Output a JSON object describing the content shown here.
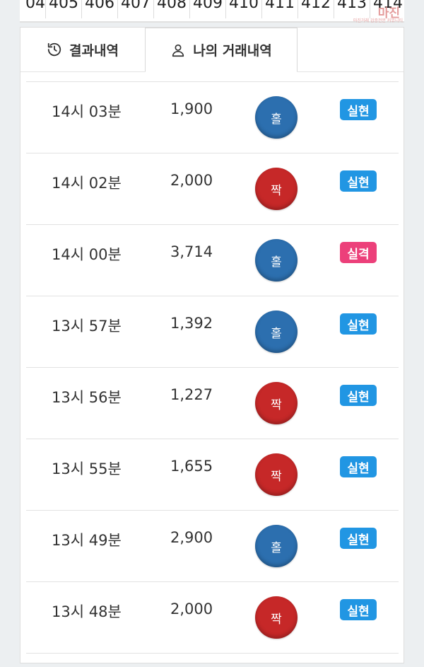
{
  "round_numbers": [
    "04",
    "405",
    "406",
    "407",
    "408",
    "409",
    "410",
    "411",
    "412",
    "413",
    "414"
  ],
  "watermark": {
    "text": "마진",
    "sub": "마진거래 검증전문 커뮤니티"
  },
  "tabs": [
    {
      "label": "결과내역",
      "icon": "history-icon"
    },
    {
      "label": "나의 거래내역",
      "icon": "user-icon",
      "active": true
    }
  ],
  "colors": {
    "odd": "#2c6faf",
    "even": "#c62828",
    "win": "#2196e3",
    "lose": "#ec407a"
  },
  "rows": [
    {
      "time": "14시 03분",
      "amount": "1,900",
      "pick": "홀",
      "pick_type": "odd",
      "result": "실현",
      "result_type": "win"
    },
    {
      "time": "14시 02분",
      "amount": "2,000",
      "pick": "짝",
      "pick_type": "even",
      "result": "실현",
      "result_type": "win"
    },
    {
      "time": "14시 00분",
      "amount": "3,714",
      "pick": "홀",
      "pick_type": "odd",
      "result": "실격",
      "result_type": "lose"
    },
    {
      "time": "13시 57분",
      "amount": "1,392",
      "pick": "홀",
      "pick_type": "odd",
      "result": "실현",
      "result_type": "win"
    },
    {
      "time": "13시 56분",
      "amount": "1,227",
      "pick": "짝",
      "pick_type": "even",
      "result": "실현",
      "result_type": "win"
    },
    {
      "time": "13시 55분",
      "amount": "1,655",
      "pick": "짝",
      "pick_type": "even",
      "result": "실현",
      "result_type": "win"
    },
    {
      "time": "13시 49분",
      "amount": "2,900",
      "pick": "홀",
      "pick_type": "odd",
      "result": "실현",
      "result_type": "win"
    },
    {
      "time": "13시 48분",
      "amount": "2,000",
      "pick": "짝",
      "pick_type": "even",
      "result": "실현",
      "result_type": "win"
    }
  ]
}
